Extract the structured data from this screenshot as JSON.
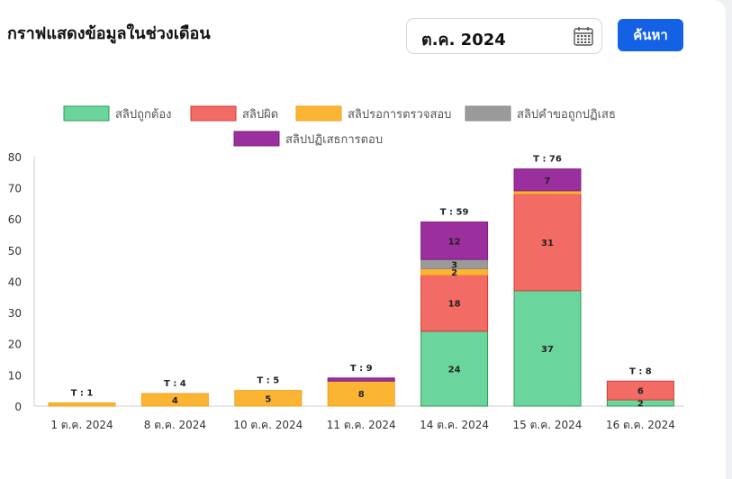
{
  "header": {
    "title": "กราฟแสดงข้อมูลในช่วงเดือน",
    "month_value": "ต.ค. 2024",
    "search_label": "ค้นหา"
  },
  "icons": {
    "calendar": "calendar-icon"
  },
  "colors": {
    "accent": "#1461e6"
  },
  "chart_data": {
    "type": "bar",
    "stacked": true,
    "categories": [
      "1 ต.ค. 2024",
      "8 ต.ค. 2024",
      "10 ต.ค. 2024",
      "11 ต.ค. 2024",
      "14 ต.ค. 2024",
      "15 ต.ค. 2024",
      "16 ต.ค. 2024"
    ],
    "series": [
      {
        "name": "สลิปถูกต้อง",
        "color": "#6ad69e",
        "border": "#2e9a4e",
        "values": [
          0,
          0,
          0,
          0,
          24,
          37,
          2
        ]
      },
      {
        "name": "สลิปผิด",
        "color": "#f26b64",
        "border": "#d63a33",
        "values": [
          0,
          0,
          0,
          0,
          18,
          31,
          6
        ]
      },
      {
        "name": "สลิปรอการตรวจสอบ",
        "color": "#fbb532",
        "border": "#f0a020",
        "values": [
          1,
          4,
          5,
          8,
          2,
          1,
          0
        ]
      },
      {
        "name": "สลิปคำขอถูกปฏิเสธ",
        "color": "#9a9a9a",
        "border": "#8a8a8a",
        "values": [
          0,
          0,
          0,
          0,
          3,
          0,
          0
        ]
      },
      {
        "name": "สลิปปฏิเสธการตอบ",
        "color": "#9b2f9e",
        "border": "#7e1f82",
        "values": [
          0,
          0,
          0,
          1,
          12,
          7,
          0
        ]
      }
    ],
    "totals": [
      "T : 1",
      "T : 4",
      "T : 5",
      "T : 9",
      "T : 59",
      "T : 76",
      "T : 8"
    ],
    "ylim": [
      0,
      80
    ],
    "yticks": [
      0,
      10,
      20,
      30,
      40,
      50,
      60,
      70,
      80
    ],
    "legend_position": "top",
    "grid": false
  }
}
